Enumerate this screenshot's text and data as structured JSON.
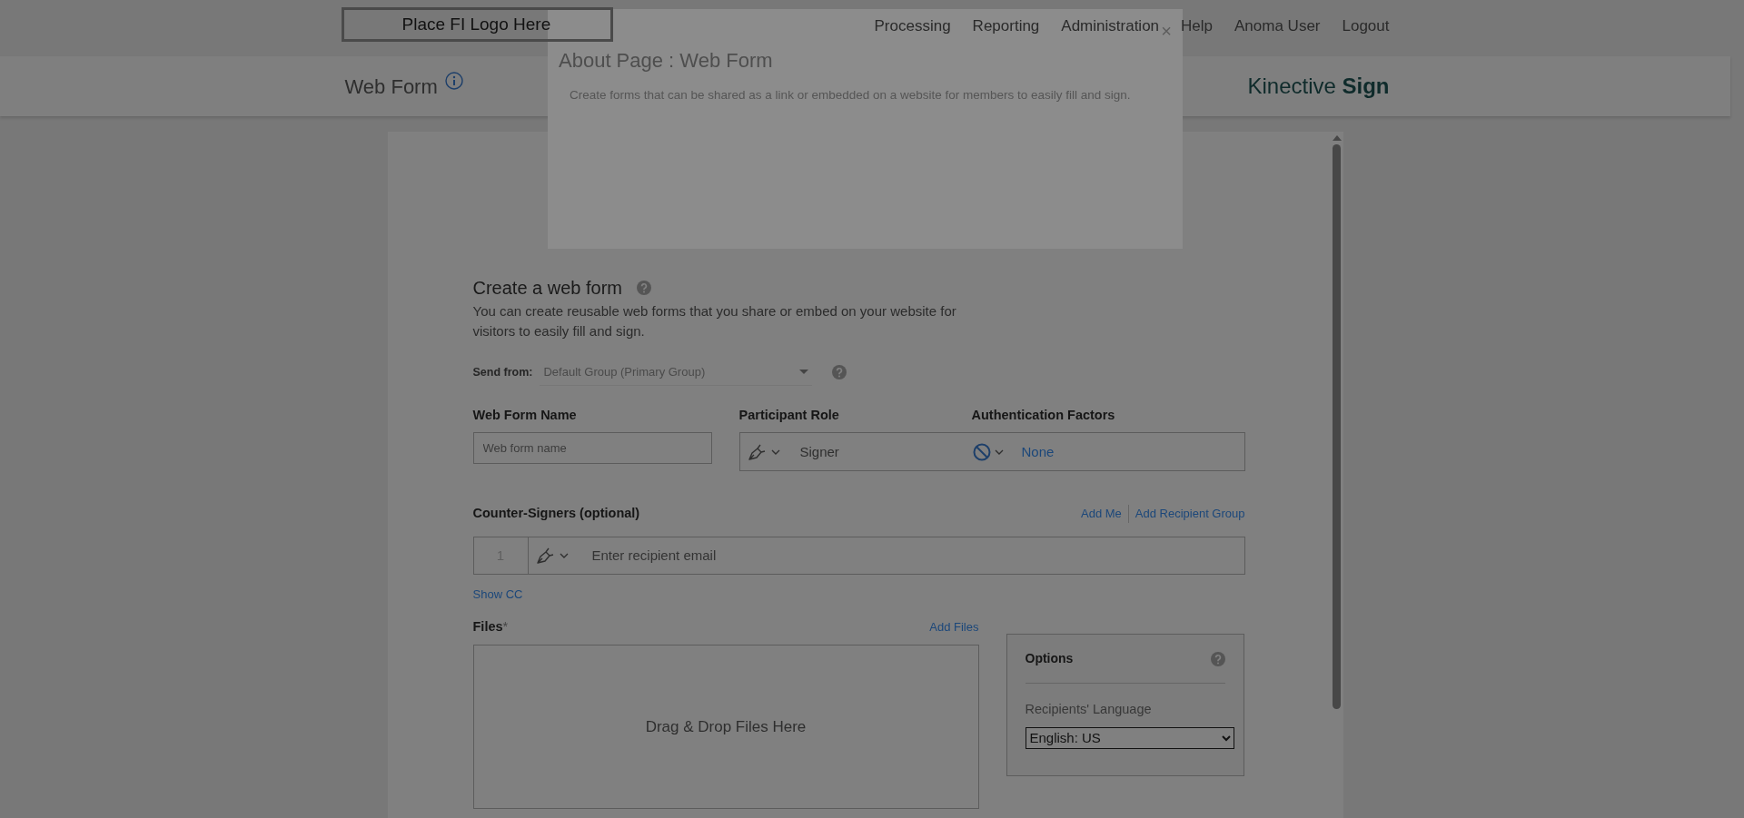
{
  "header": {
    "logo": "Place FI Logo Here",
    "nav": [
      "Processing",
      "Reporting",
      "Administration",
      "Help",
      "Anoma User",
      "Logout"
    ]
  },
  "page_bar": {
    "title": "Web Form",
    "brand": "Kinective **Sign**"
  },
  "popover": {
    "title": "About Page : Web Form",
    "close": "×",
    "text": "Create forms that can be shared as a link or embedded on a website for members to easily fill and sign."
  },
  "form": {
    "title": "Create a web form",
    "description": "You can create reusable web forms that you share or embed on your website for visitors to easily fill and sign.",
    "send_from": {
      "label": "Send from:",
      "value": "Default Group (Primary Group)"
    },
    "name_field": {
      "label": "Web Form Name",
      "placeholder": "Web form name"
    },
    "participant_role": {
      "label": "Participant Role",
      "value": "Signer"
    },
    "authentication": {
      "label": "Authentication Factors",
      "value": "None"
    },
    "counter_signers": {
      "label": "Counter-Signers (optional)",
      "links": [
        "Add Me",
        "Add Recipient Group"
      ],
      "rows": [
        {
          "number": "1",
          "placeholder": "Enter recipient email"
        }
      ]
    },
    "show_cc": "Show CC",
    "files": {
      "label": "Files",
      "required_mark": "*",
      "add": "Add Files",
      "drop": "Drag & Drop Files Here"
    },
    "options": {
      "title": "Options",
      "language_label": "Recipients' Language",
      "language_value": "English: US"
    }
  }
}
